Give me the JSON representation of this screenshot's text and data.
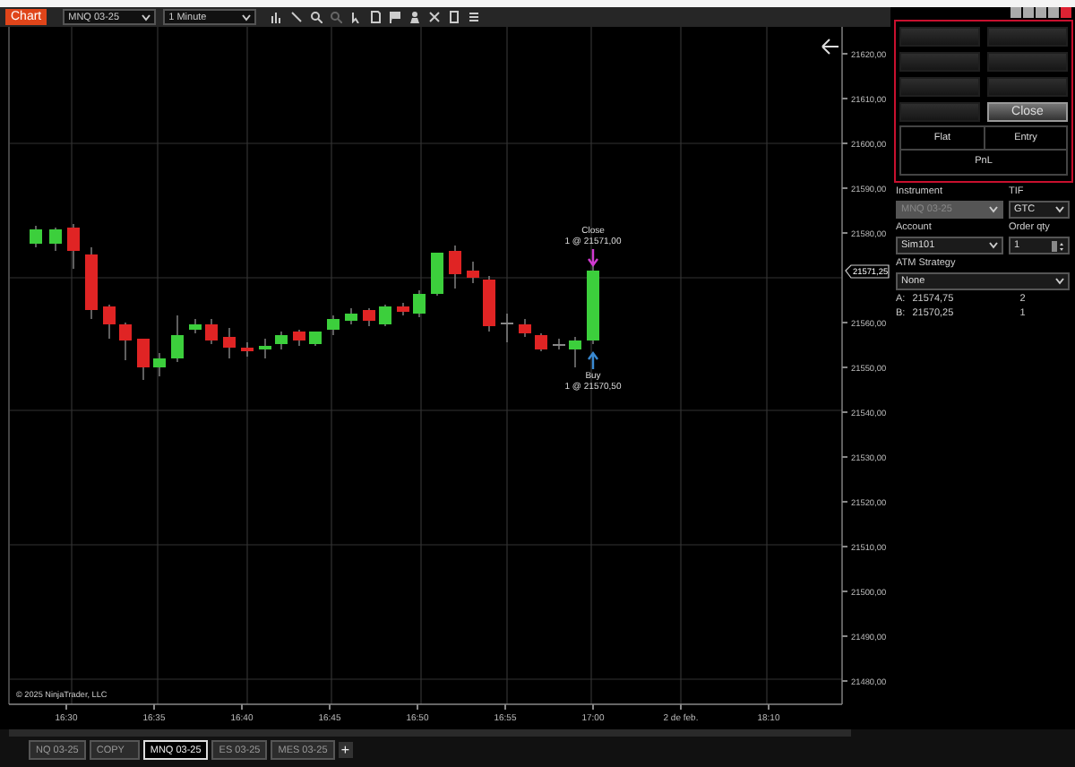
{
  "toolbar": {
    "title": "Chart",
    "instrument": "MNQ 03-25",
    "interval": "1 Minute"
  },
  "chart": {
    "price_labels": [
      "21620,00",
      "21610,00",
      "21600,00",
      "21590,00",
      "21580,00",
      "21560,00",
      "21550,00",
      "21540,00",
      "21530,00",
      "21520,00",
      "21510,00",
      "21500,00",
      "21490,00",
      "21480,00"
    ],
    "current_price": "21571,25",
    "time_labels": [
      "16:30",
      "16:35",
      "16:40",
      "16:45",
      "16:50",
      "16:55",
      "17:00",
      "2 de feb.",
      "18:10"
    ],
    "trade_markers": [
      {
        "kind": "exit",
        "label": "Close",
        "detail": "1 @ 21571,00"
      },
      {
        "kind": "entry",
        "label": "Buy",
        "detail": "1 @ 21570,50"
      }
    ],
    "copyright": "© 2025 NinjaTrader, LLC"
  },
  "order_panel": {
    "quick_buttons": [
      {
        "disabled": true
      },
      {
        "disabled": true
      },
      {
        "disabled": true
      },
      {
        "disabled": true
      },
      {
        "disabled": true
      },
      {
        "disabled": true
      },
      {
        "disabled": true
      },
      {
        "label": "Close",
        "disabled": false
      }
    ],
    "flat": "Flat",
    "entry": "Entry",
    "pnl": "PnL",
    "instrument_label": "Instrument",
    "instrument": {
      "value": "MNQ 03-25",
      "disabled": true
    },
    "tif_label": "TIF",
    "tif": "GTC",
    "account_label": "Account",
    "account": "Sim101",
    "qty_label": "Order qty",
    "qty": "1",
    "atm_label": "ATM Strategy",
    "atm": "None",
    "quotes": [
      {
        "label": "A:",
        "price": "21574,75",
        "size": "2"
      },
      {
        "label": "B:",
        "price": "21570,25",
        "size": "1"
      }
    ]
  },
  "tabs": [
    {
      "label": "NQ 03-25",
      "selected": false
    },
    {
      "label": "COPY",
      "selected": false
    },
    {
      "label": "MNQ 03-25",
      "selected": true
    },
    {
      "label": "ES 03-25",
      "selected": false
    },
    {
      "label": "MES 03-25",
      "selected": false
    }
  ],
  "add_tab": "+"
}
